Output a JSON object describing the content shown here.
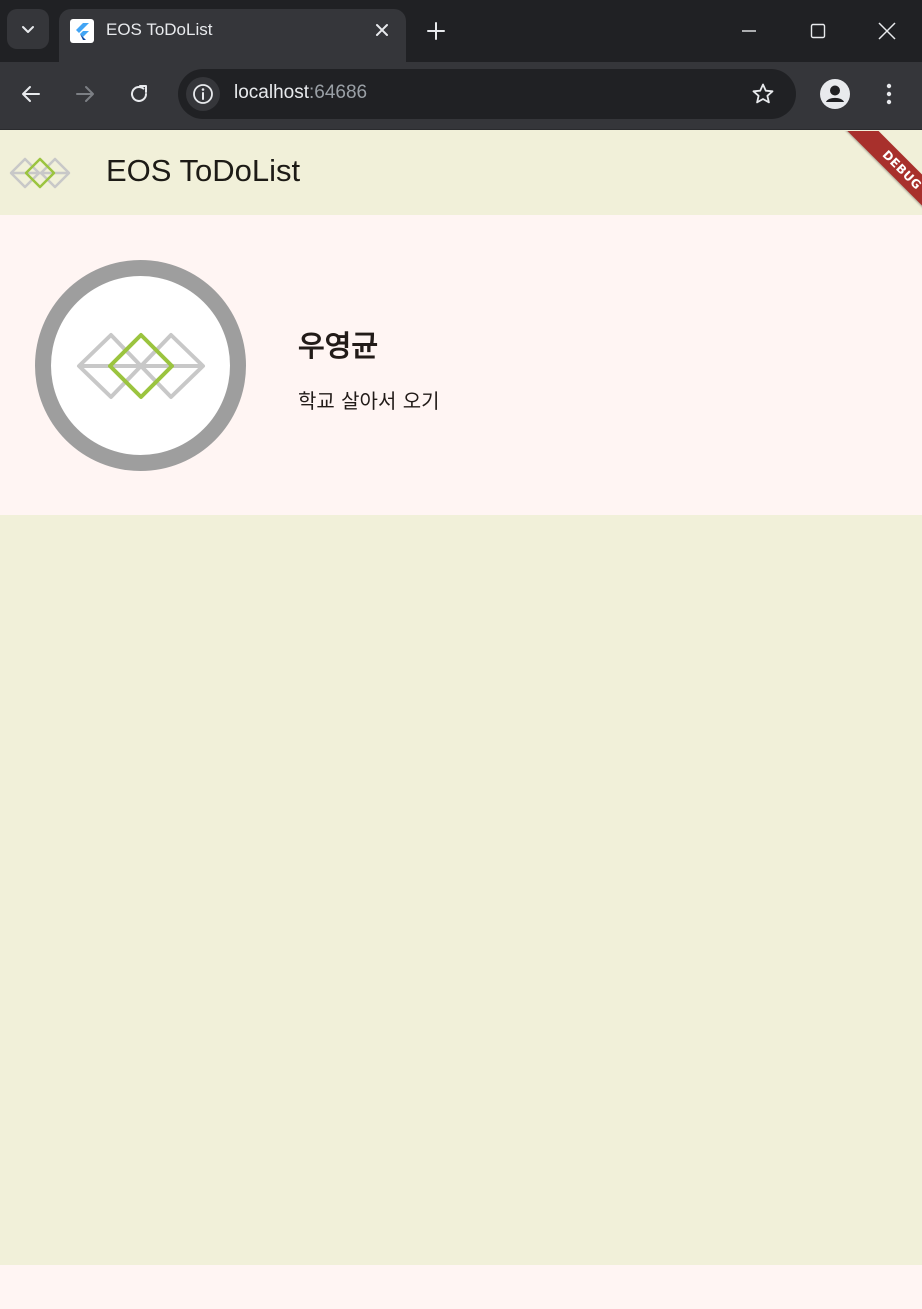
{
  "browser": {
    "tab_title": "EOS ToDoList",
    "url_host": "localhost",
    "url_port": ":64686"
  },
  "app": {
    "title": "EOS ToDoList",
    "debug_label": "DEBUG"
  },
  "profile": {
    "name": "우영균",
    "description": "학교 살아서 오기"
  },
  "colors": {
    "appbar_bg": "#f1f0d9",
    "card_bg": "#fff5f3",
    "logo_green": "#9bc43f",
    "logo_gray": "#c8c8c8",
    "avatar_ring": "#9e9e9e",
    "debug_ribbon": "#a8302c"
  }
}
